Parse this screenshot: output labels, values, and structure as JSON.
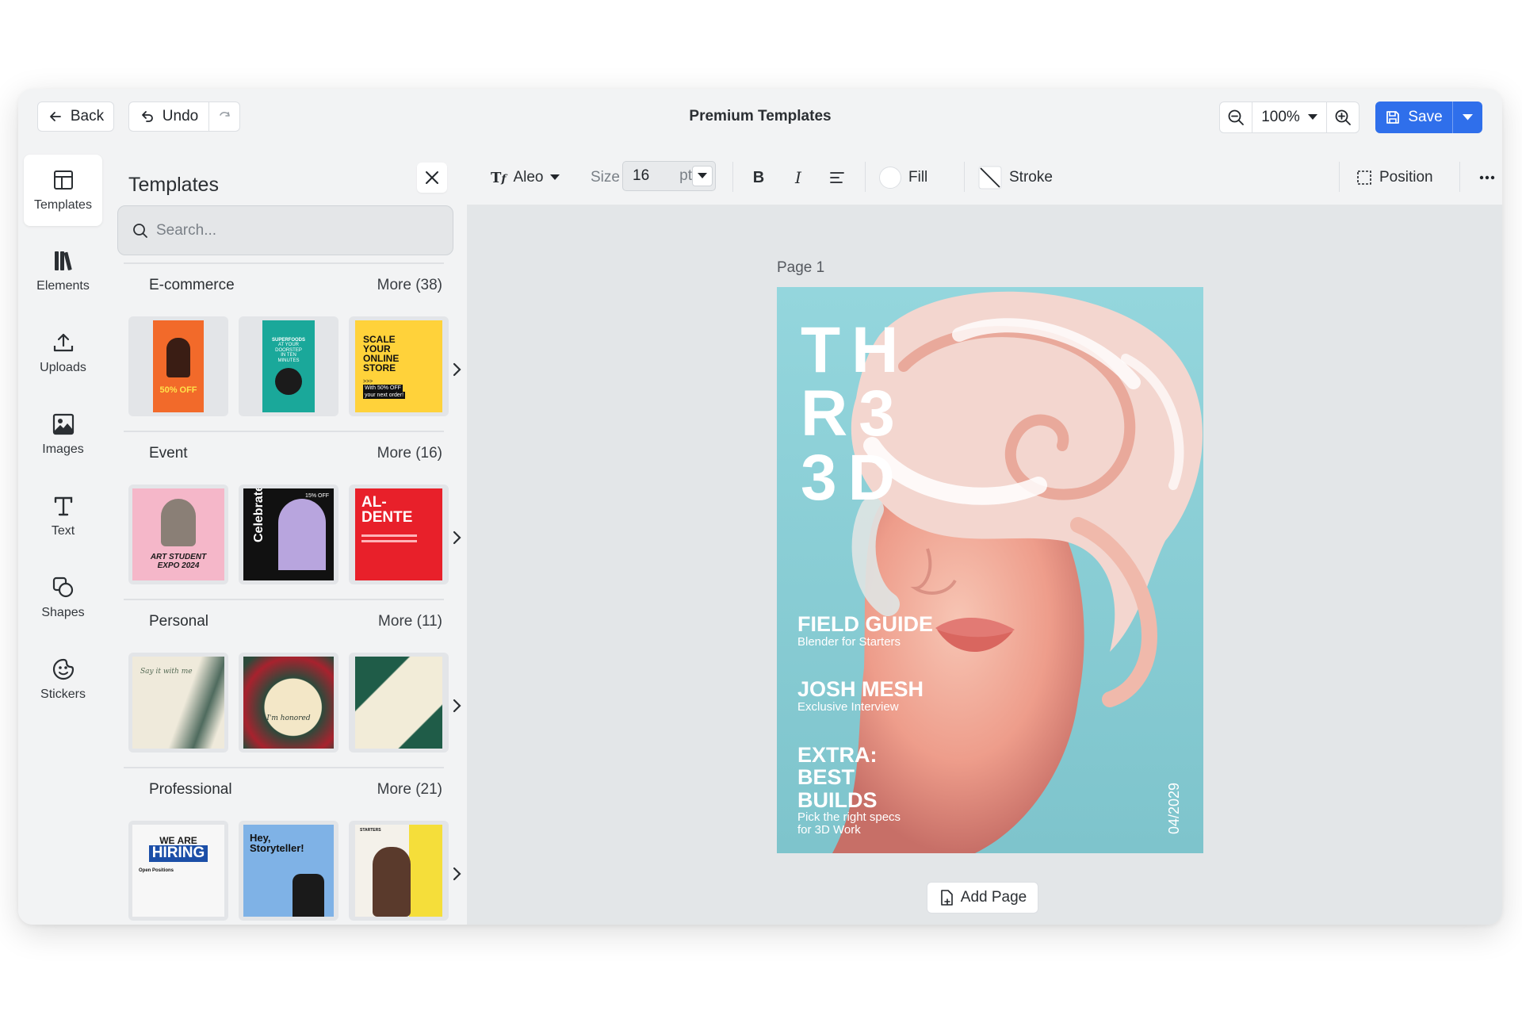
{
  "topbar": {
    "back_label": "Back",
    "undo_label": "Undo",
    "title": "Premium Templates",
    "zoom_value": "100%",
    "save_label": "Save"
  },
  "rail": {
    "items": [
      {
        "label": "Templates",
        "icon": "templates-icon"
      },
      {
        "label": "Elements",
        "icon": "elements-icon"
      },
      {
        "label": "Uploads",
        "icon": "upload-icon"
      },
      {
        "label": "Images",
        "icon": "image-icon"
      },
      {
        "label": "Text",
        "icon": "text-icon"
      },
      {
        "label": "Shapes",
        "icon": "shapes-icon"
      },
      {
        "label": "Stickers",
        "icon": "sticker-icon"
      }
    ]
  },
  "panel": {
    "title": "Templates",
    "search_placeholder": "Search...",
    "categories": [
      {
        "name": "E-commerce",
        "more": "More (38)",
        "thumbs": [
          {
            "lines": [
              "50% OFF"
            ],
            "bg": "#f26a2a",
            "fg": "#ffe24a"
          },
          {
            "lines": [
              "SUPERFOODS",
              "AT YOUR",
              "DOORSTEP",
              "IN TEN",
              "MINUTES"
            ],
            "bg": "#1aa89a",
            "fg": "#ffffff"
          },
          {
            "lines": [
              "SCALE",
              "YOUR",
              "ONLINE",
              "STORE",
              ">>>",
              "With 50% OFF",
              "your next order!"
            ],
            "bg": "#ffd23a",
            "fg": "#111111"
          }
        ]
      },
      {
        "name": "Event",
        "more": "More (16)",
        "thumbs": [
          {
            "lines": [
              "ART STUDENT",
              "EXPO 2024"
            ],
            "bg": "#f5b7c9",
            "fg": "#1a1a1a"
          },
          {
            "lines": [
              "Celebrate",
              "15% OFF"
            ],
            "bg": "#111111",
            "fg": "#ffffff"
          },
          {
            "lines": [
              "AL-",
              "DENTE"
            ],
            "bg": "#e8202a",
            "fg": "#ffffff"
          }
        ]
      },
      {
        "name": "Personal",
        "more": "More (11)",
        "thumbs": [
          {
            "lines": [
              "Say it with me"
            ],
            "bg": "#efeadb",
            "fg": "#556b55"
          },
          {
            "lines": [
              "I'm honored"
            ],
            "bg": "#f3e7c7",
            "fg": "#2c3b33"
          },
          {
            "lines": [
              ""
            ],
            "bg": "#f2ecd8",
            "fg": "#2c3b33"
          }
        ]
      },
      {
        "name": "Professional",
        "more": "More (21)",
        "thumbs": [
          {
            "lines": [
              "WE ARE",
              "HIRING",
              "Open Positions"
            ],
            "bg": "#f7f7f7",
            "fg": "#1c4fa8"
          },
          {
            "lines": [
              "Hey,",
              "Storyteller!"
            ],
            "bg": "#7fb2e6",
            "fg": "#111111"
          },
          {
            "lines": [
              "STARTERS"
            ],
            "bg": "#f4f1ea",
            "fg": "#111111"
          }
        ]
      }
    ]
  },
  "toolbar": {
    "font": "Aleo",
    "size_label": "Size",
    "size_value": "16",
    "size_unit": "pt",
    "fill_label": "Fill",
    "stroke_label": "Stroke",
    "position_label": "Position"
  },
  "canvas": {
    "page_label": "Page  1",
    "add_page_label": "Add Page",
    "poster": {
      "logo": [
        "TH",
        "R3",
        "3D"
      ],
      "blocks": [
        {
          "headline": "FIELD GUIDE",
          "sub": "Blender for Starters"
        },
        {
          "headline": "JOSH MESH",
          "sub": "Exclusive Interview"
        },
        {
          "headline": "EXTRA:\nBEST\nBUILDS",
          "sub": "Pick the right specs\nfor 3D Work"
        }
      ],
      "date": "04/2029"
    }
  },
  "colors": {
    "accent": "#2f6feb",
    "poster_bg": "#8fd0d8"
  }
}
